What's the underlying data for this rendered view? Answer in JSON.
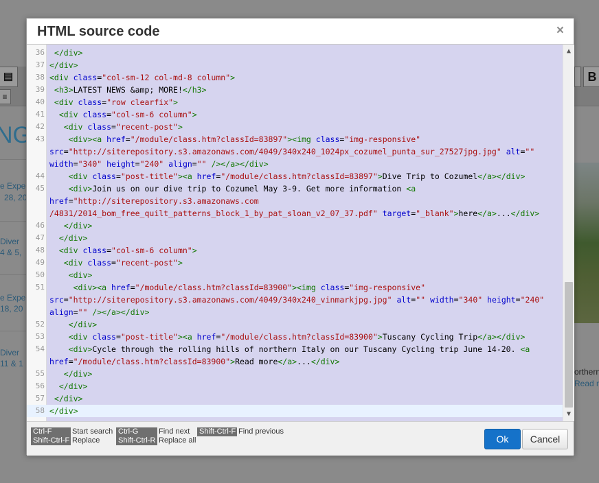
{
  "background": {
    "heading_fragment": "NG",
    "side_items": [
      {
        "text": "e Expe"
      },
      {
        "text": "28, 20"
      },
      {
        "text": "Diver"
      },
      {
        "text": "4 & 5,"
      },
      {
        "text": "e Expe"
      },
      {
        "text": "18, 20"
      },
      {
        "text": "Diver"
      },
      {
        "text": "11 & 1"
      }
    ],
    "right_text_1": "orthern",
    "right_text_2": "Read m",
    "toolbar_btn_b": "B"
  },
  "dialog": {
    "title": "HTML source code",
    "close_label": "×",
    "ok_label": "Ok",
    "cancel_label": "Cancel"
  },
  "shortcuts": [
    {
      "key": "Ctrl-F",
      "desc": "Start search"
    },
    {
      "key": "Shift-Ctrl-F",
      "desc": "Replace"
    },
    {
      "key": "Ctrl-G",
      "desc": "Find next"
    },
    {
      "key": "Shift-Ctrl-R",
      "desc": "Replace all"
    },
    {
      "key": "Shift-Ctrl-F",
      "desc": "Find previous"
    }
  ],
  "editor": {
    "active_line": "58",
    "lines": [
      {
        "no": "36",
        "tokens": [
          {
            "t": "tag",
            "v": " </div>"
          }
        ]
      },
      {
        "no": "37",
        "tokens": [
          {
            "t": "tag",
            "v": "</div>"
          }
        ]
      },
      {
        "no": "38",
        "tokens": [
          {
            "t": "tag",
            "v": "<div "
          },
          {
            "t": "att",
            "v": "class"
          },
          {
            "t": "txt",
            "v": "="
          },
          {
            "t": "str",
            "v": "\"col-sm-12 col-md-8 column\""
          },
          {
            "t": "tag",
            "v": ">"
          }
        ]
      },
      {
        "no": "39",
        "tokens": [
          {
            "t": "tag",
            "v": " <h3>"
          },
          {
            "t": "txt",
            "v": "LATEST NEWS &amp; MORE!"
          },
          {
            "t": "tag",
            "v": "</h3>"
          }
        ]
      },
      {
        "no": "40",
        "tokens": [
          {
            "t": "tag",
            "v": " <div "
          },
          {
            "t": "att",
            "v": "class"
          },
          {
            "t": "txt",
            "v": "="
          },
          {
            "t": "str",
            "v": "\"row clearfix\""
          },
          {
            "t": "tag",
            "v": ">"
          }
        ]
      },
      {
        "no": "41",
        "tokens": [
          {
            "t": "tag",
            "v": "  <div "
          },
          {
            "t": "att",
            "v": "class"
          },
          {
            "t": "txt",
            "v": "="
          },
          {
            "t": "str",
            "v": "\"col-sm-6 column\""
          },
          {
            "t": "tag",
            "v": ">"
          }
        ]
      },
      {
        "no": "42",
        "tokens": [
          {
            "t": "tag",
            "v": "   <div "
          },
          {
            "t": "att",
            "v": "class"
          },
          {
            "t": "txt",
            "v": "="
          },
          {
            "t": "str",
            "v": "\"recent-post\""
          },
          {
            "t": "tag",
            "v": ">"
          }
        ]
      },
      {
        "no": "43",
        "tokens": [
          {
            "t": "tag",
            "v": "    <div><a "
          },
          {
            "t": "att",
            "v": "href"
          },
          {
            "t": "txt",
            "v": "="
          },
          {
            "t": "str",
            "v": "\"/module/class.htm?classId=83897\""
          },
          {
            "t": "tag",
            "v": "><img "
          },
          {
            "t": "att",
            "v": "class"
          },
          {
            "t": "txt",
            "v": "="
          },
          {
            "t": "str",
            "v": "\"img-responsive\""
          }
        ]
      },
      {
        "no": "",
        "tokens": [
          {
            "t": "att",
            "v": "src"
          },
          {
            "t": "txt",
            "v": "="
          },
          {
            "t": "str",
            "v": "\"http://siterepository.s3.amazonaws.com/4049/340x240_1024px_cozumel_punta_sur_27527jpg.jpg\""
          },
          {
            "t": "txt",
            "v": " "
          },
          {
            "t": "att",
            "v": "alt"
          },
          {
            "t": "txt",
            "v": "="
          },
          {
            "t": "str",
            "v": "\"\""
          }
        ]
      },
      {
        "no": "",
        "tokens": [
          {
            "t": "att",
            "v": "width"
          },
          {
            "t": "txt",
            "v": "="
          },
          {
            "t": "str",
            "v": "\"340\""
          },
          {
            "t": "txt",
            "v": " "
          },
          {
            "t": "att",
            "v": "height"
          },
          {
            "t": "txt",
            "v": "="
          },
          {
            "t": "str",
            "v": "\"240\""
          },
          {
            "t": "txt",
            "v": " "
          },
          {
            "t": "att",
            "v": "align"
          },
          {
            "t": "txt",
            "v": "="
          },
          {
            "t": "str",
            "v": "\"\""
          },
          {
            "t": "txt",
            "v": " "
          },
          {
            "t": "tag",
            "v": "/></a></div>"
          }
        ]
      },
      {
        "no": "44",
        "tokens": [
          {
            "t": "tag",
            "v": "    <div "
          },
          {
            "t": "att",
            "v": "class"
          },
          {
            "t": "txt",
            "v": "="
          },
          {
            "t": "str",
            "v": "\"post-title\""
          },
          {
            "t": "tag",
            "v": "><a "
          },
          {
            "t": "att",
            "v": "href"
          },
          {
            "t": "txt",
            "v": "="
          },
          {
            "t": "str",
            "v": "\"/module/class.htm?classId=83897\""
          },
          {
            "t": "tag",
            "v": ">"
          },
          {
            "t": "txt",
            "v": "Dive Trip to Cozumel"
          },
          {
            "t": "tag",
            "v": "</a></div>"
          }
        ]
      },
      {
        "no": "45",
        "tokens": [
          {
            "t": "tag",
            "v": "    <div>"
          },
          {
            "t": "txt",
            "v": "Join us on our dive trip to Cozumel May 3-9. Get more information "
          },
          {
            "t": "tag",
            "v": "<a"
          }
        ]
      },
      {
        "no": "",
        "tokens": [
          {
            "t": "att",
            "v": "href"
          },
          {
            "t": "txt",
            "v": "="
          },
          {
            "t": "str",
            "v": "\"http://siterepository.s3.amazonaws.com"
          }
        ]
      },
      {
        "no": "",
        "tokens": [
          {
            "t": "str",
            "v": "/4831/2014_bom_free_quilt_patterns_block_1_by_pat_sloan_v2_07_37.pdf\""
          },
          {
            "t": "txt",
            "v": " "
          },
          {
            "t": "att",
            "v": "target"
          },
          {
            "t": "txt",
            "v": "="
          },
          {
            "t": "str",
            "v": "\"_blank\""
          },
          {
            "t": "tag",
            "v": ">"
          },
          {
            "t": "txt",
            "v": "here"
          },
          {
            "t": "tag",
            "v": "</a>"
          },
          {
            "t": "txt",
            "v": "..."
          },
          {
            "t": "tag",
            "v": "</div>"
          }
        ]
      },
      {
        "no": "46",
        "tokens": [
          {
            "t": "tag",
            "v": "   </div>"
          }
        ]
      },
      {
        "no": "47",
        "tokens": [
          {
            "t": "tag",
            "v": "  </div>"
          }
        ]
      },
      {
        "no": "48",
        "tokens": [
          {
            "t": "tag",
            "v": "  <div "
          },
          {
            "t": "att",
            "v": "class"
          },
          {
            "t": "txt",
            "v": "="
          },
          {
            "t": "str",
            "v": "\"col-sm-6 column\""
          },
          {
            "t": "tag",
            "v": ">"
          }
        ]
      },
      {
        "no": "49",
        "tokens": [
          {
            "t": "tag",
            "v": "   <div "
          },
          {
            "t": "att",
            "v": "class"
          },
          {
            "t": "txt",
            "v": "="
          },
          {
            "t": "str",
            "v": "\"recent-post\""
          },
          {
            "t": "tag",
            "v": ">"
          }
        ]
      },
      {
        "no": "50",
        "tokens": [
          {
            "t": "tag",
            "v": "    <div>"
          }
        ]
      },
      {
        "no": "51",
        "tokens": [
          {
            "t": "tag",
            "v": "     <div><a "
          },
          {
            "t": "att",
            "v": "href"
          },
          {
            "t": "txt",
            "v": "="
          },
          {
            "t": "str",
            "v": "\"/module/class.htm?classId=83900\""
          },
          {
            "t": "tag",
            "v": "><img "
          },
          {
            "t": "att",
            "v": "class"
          },
          {
            "t": "txt",
            "v": "="
          },
          {
            "t": "str",
            "v": "\"img-responsive\""
          }
        ]
      },
      {
        "no": "",
        "tokens": [
          {
            "t": "att",
            "v": "src"
          },
          {
            "t": "txt",
            "v": "="
          },
          {
            "t": "str",
            "v": "\"http://siterepository.s3.amazonaws.com/4049/340x240_vinmarkjpg.jpg\""
          },
          {
            "t": "txt",
            "v": " "
          },
          {
            "t": "att",
            "v": "alt"
          },
          {
            "t": "txt",
            "v": "="
          },
          {
            "t": "str",
            "v": "\"\""
          },
          {
            "t": "txt",
            "v": " "
          },
          {
            "t": "att",
            "v": "width"
          },
          {
            "t": "txt",
            "v": "="
          },
          {
            "t": "str",
            "v": "\"340\""
          },
          {
            "t": "txt",
            "v": " "
          },
          {
            "t": "att",
            "v": "height"
          },
          {
            "t": "txt",
            "v": "="
          },
          {
            "t": "str",
            "v": "\"240\""
          }
        ]
      },
      {
        "no": "",
        "tokens": [
          {
            "t": "att",
            "v": "align"
          },
          {
            "t": "txt",
            "v": "="
          },
          {
            "t": "str",
            "v": "\"\""
          },
          {
            "t": "txt",
            "v": " "
          },
          {
            "t": "tag",
            "v": "/></a></div>"
          }
        ]
      },
      {
        "no": "52",
        "tokens": [
          {
            "t": "tag",
            "v": "    </div>"
          }
        ]
      },
      {
        "no": "53",
        "tokens": [
          {
            "t": "tag",
            "v": "    <div "
          },
          {
            "t": "att",
            "v": "class"
          },
          {
            "t": "txt",
            "v": "="
          },
          {
            "t": "str",
            "v": "\"post-title\""
          },
          {
            "t": "tag",
            "v": "><a "
          },
          {
            "t": "att",
            "v": "href"
          },
          {
            "t": "txt",
            "v": "="
          },
          {
            "t": "str",
            "v": "\"/module/class.htm?classId=83900\""
          },
          {
            "t": "tag",
            "v": ">"
          },
          {
            "t": "txt",
            "v": "Tuscany Cycling Trip"
          },
          {
            "t": "tag",
            "v": "</a></div>"
          }
        ]
      },
      {
        "no": "54",
        "tokens": [
          {
            "t": "tag",
            "v": "    <div>"
          },
          {
            "t": "txt",
            "v": "Cycle through the rolling hills of northern Italy on our Tuscany Cycling trip June 14-20. "
          },
          {
            "t": "tag",
            "v": "<a"
          }
        ]
      },
      {
        "no": "",
        "tokens": [
          {
            "t": "att",
            "v": "href"
          },
          {
            "t": "txt",
            "v": "="
          },
          {
            "t": "str",
            "v": "\"/module/class.htm?classId=83900\""
          },
          {
            "t": "tag",
            "v": ">"
          },
          {
            "t": "txt",
            "v": "Read more"
          },
          {
            "t": "tag",
            "v": "</a>"
          },
          {
            "t": "txt",
            "v": "..."
          },
          {
            "t": "tag",
            "v": "</div>"
          }
        ]
      },
      {
        "no": "55",
        "tokens": [
          {
            "t": "tag",
            "v": "   </div>"
          }
        ]
      },
      {
        "no": "56",
        "tokens": [
          {
            "t": "tag",
            "v": "  </div>"
          }
        ]
      },
      {
        "no": "57",
        "tokens": [
          {
            "t": "tag",
            "v": " </div>"
          }
        ]
      },
      {
        "no": "58",
        "tokens": [
          {
            "t": "tag",
            "v": "</div>"
          }
        ]
      }
    ]
  }
}
